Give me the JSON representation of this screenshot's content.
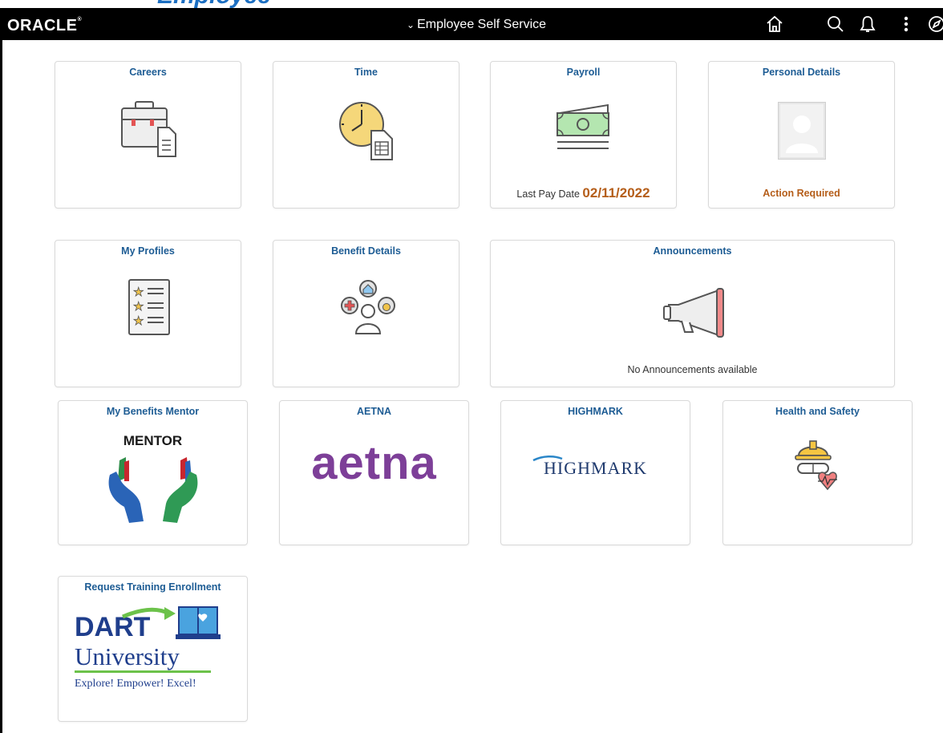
{
  "app": {
    "title_partial": "Employee",
    "brand": "ORACLE",
    "nav_title": "Employee Self Service"
  },
  "toolbar": {
    "icons": [
      "home-icon",
      "search-icon",
      "notification-bell-icon",
      "more-actions-icon",
      "navbar-icon"
    ]
  },
  "tiles": {
    "careers": {
      "title": "Careers"
    },
    "time": {
      "title": "Time"
    },
    "payroll": {
      "title": "Payroll",
      "footer_label": "Last Pay Date",
      "footer_value": "02/11/2022"
    },
    "personal_details": {
      "title": "Personal Details",
      "footer": "Action Required"
    },
    "my_profiles": {
      "title": "My Profiles"
    },
    "benefit_details": {
      "title": "Benefit Details"
    },
    "announcements": {
      "title": "Announcements",
      "footer": "No Announcements available"
    },
    "benefits_mentor": {
      "title": "My Benefits Mentor",
      "logo_text": "MENTOR"
    },
    "aetna": {
      "title": "AETNA",
      "logo_text": "aetna"
    },
    "highmark": {
      "title": "HIGHMARK",
      "logo_text": "HIGHMARK"
    },
    "health_safety": {
      "title": "Health and Safety"
    },
    "training": {
      "title": "Request Training Enrollment",
      "logo_line1": "DART",
      "logo_line2": "University",
      "logo_line3": "Explore! Empower! Excel!"
    }
  },
  "colors": {
    "topbar": "#000000",
    "tile_title": "#1d5c94",
    "accent_orange": "#b55e1a",
    "aetna_purple": "#7d3f98"
  }
}
